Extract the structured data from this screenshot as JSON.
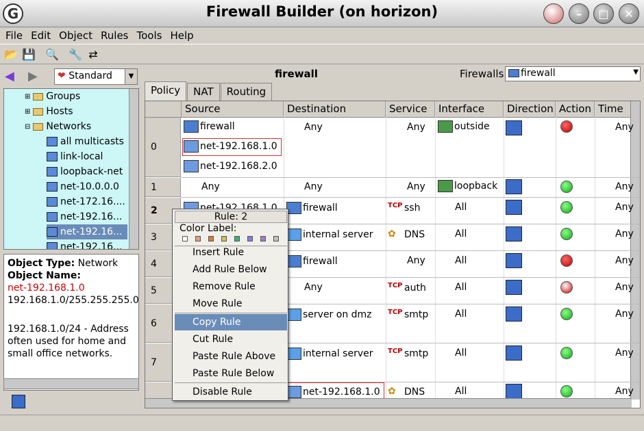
{
  "window": {
    "title": "Firewall Builder (on horizon)"
  },
  "menu": [
    "File",
    "Edit",
    "Object",
    "Rules",
    "Tools",
    "Help"
  ],
  "nav": {
    "library": "Standard"
  },
  "tree": [
    {
      "label": "Groups",
      "kind": "folder"
    },
    {
      "label": "Hosts",
      "kind": "folder"
    },
    {
      "label": "Networks",
      "kind": "folder"
    },
    {
      "label": "all multicasts",
      "kind": "net"
    },
    {
      "label": "link-local",
      "kind": "net"
    },
    {
      "label": "loopback-net",
      "kind": "net"
    },
    {
      "label": "net-10.0.0.0",
      "kind": "net"
    },
    {
      "label": "net-172.16....",
      "kind": "net"
    },
    {
      "label": "net-192.16...",
      "kind": "net"
    },
    {
      "label": "net-192.16...",
      "kind": "net",
      "selected": true
    },
    {
      "label": "net-192.16...",
      "kind": "net"
    }
  ],
  "info": {
    "type_label": "Object Type:",
    "type_value": "Network",
    "name_label": "Object Name:",
    "name_value": "net-192.168.1.0",
    "address": "192.168.1.0/255.255.255.0",
    "description": "192.168.1.0/24 - Address often used for home and small office networks."
  },
  "firewall": {
    "title": "firewall",
    "label": "Firewalls:",
    "selected": "firewall"
  },
  "tabs": [
    "Policy",
    "NAT",
    "Routing"
  ],
  "columns": [
    "Source",
    "Destination",
    "Service",
    "Interface",
    "Direction",
    "Action",
    "Time"
  ],
  "rows": [
    {
      "num": "0",
      "source": [
        "firewall",
        "net-192.168.1.0",
        "net-192.168.2.0"
      ],
      "destination": "Any",
      "service": "Any",
      "interface": "outside",
      "action": "deny",
      "time": "Any"
    },
    {
      "num": "1",
      "source": [
        "Any"
      ],
      "destination": "Any",
      "service": "Any",
      "interface": "loopback",
      "action": "accept",
      "time": "Any"
    },
    {
      "num": "2",
      "source": [
        "net-192.168.1.0"
      ],
      "destination": "firewall",
      "service": "ssh",
      "interface": "All",
      "action": "accept",
      "time": "Any"
    },
    {
      "num": "3",
      "source": [],
      "destination": "internal server",
      "service": "DNS",
      "interface": "All",
      "action": "accept",
      "time": "Any"
    },
    {
      "num": "4",
      "source": [],
      "destination": "firewall",
      "service": "Any",
      "interface": "All",
      "action": "deny",
      "time": "Any"
    },
    {
      "num": "5",
      "source": [],
      "destination": "Any",
      "service": "auth",
      "interface": "All",
      "action": "reject",
      "time": "Any"
    },
    {
      "num": "6",
      "source": [],
      "destination": "server on dmz",
      "service": "smtp",
      "interface": "All",
      "action": "accept",
      "time": "Any"
    },
    {
      "num": "7",
      "source": [],
      "destination": "internal server",
      "service": "smtp",
      "interface": "All",
      "action": "accept",
      "time": "Any"
    },
    {
      "num": "",
      "source": [],
      "destination": "net-192.168.1.0",
      "service": "DNS",
      "interface": "All",
      "action": "accept",
      "time": "Any"
    }
  ],
  "context_menu": {
    "header": "Rule: 2",
    "color_label": "Color Label:",
    "swatches": [
      "#ffffff",
      "#e0a080",
      "#d08040",
      "#d0c060",
      "#40b080",
      "#8080e0",
      "#a080d0",
      "#c0c0c0"
    ],
    "items": [
      "Insert Rule",
      "Add Rule Below",
      "Remove Rule",
      "Move Rule",
      "Copy Rule",
      "Cut Rule",
      "Paste Rule Above",
      "Paste Rule Below",
      "Disable Rule"
    ],
    "highlighted": "Copy Rule"
  }
}
